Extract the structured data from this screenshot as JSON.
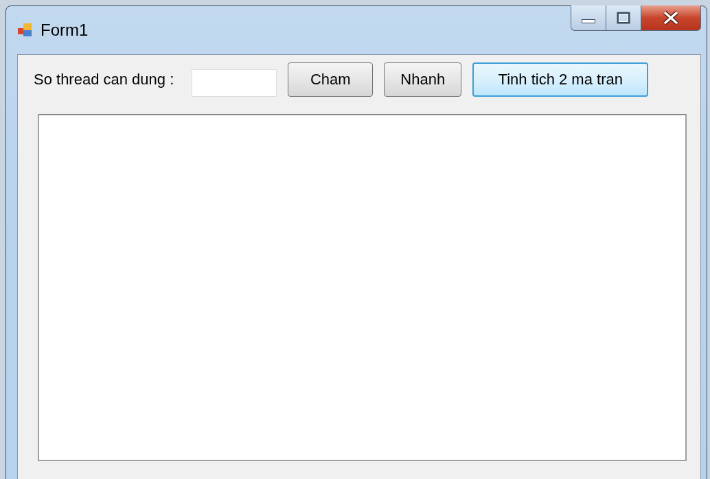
{
  "window": {
    "title": "Form1"
  },
  "form": {
    "label": "So thread can dung :",
    "buttons": [
      {
        "label": "Cham",
        "focused": false
      },
      {
        "label": "Nhanh",
        "focused": false
      },
      {
        "label": "Tinh tich 2 ma tran",
        "focused": true
      }
    ]
  }
}
